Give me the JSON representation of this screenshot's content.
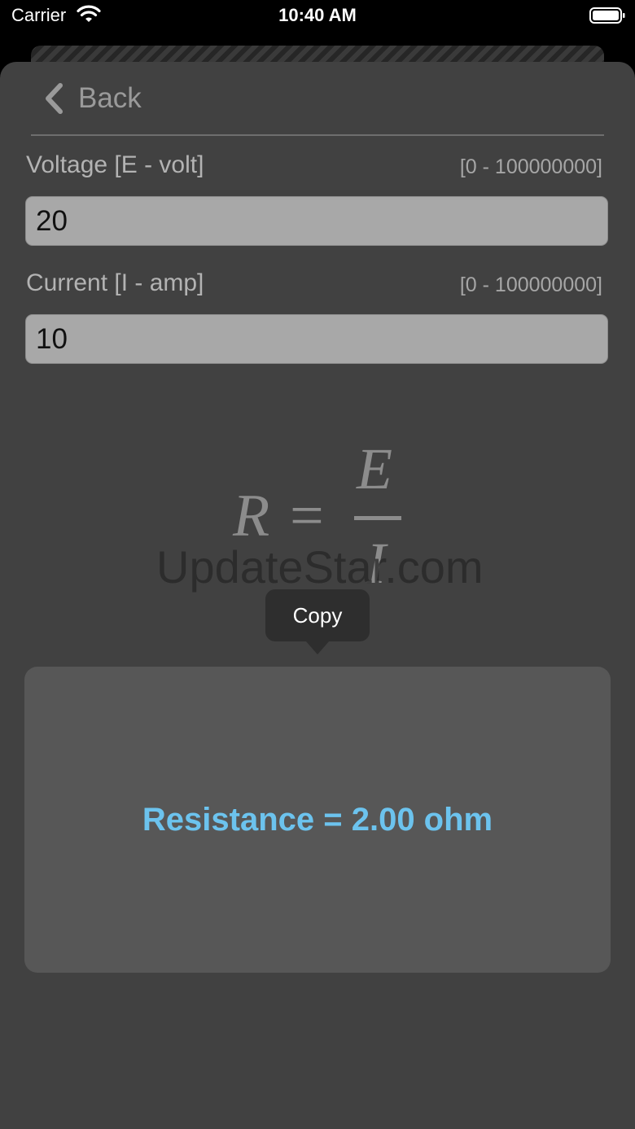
{
  "status_bar": {
    "carrier": "Carrier",
    "time": "10:40 AM"
  },
  "nav": {
    "back_label": "Back"
  },
  "voltage": {
    "label": "Voltage [E - volt]",
    "range": "[0 - 100000000]",
    "value": "20"
  },
  "current": {
    "label": "Current [I - amp]",
    "range": "[0 - 100000000]",
    "value": "10"
  },
  "formula": {
    "lhs": "R",
    "equals": "=",
    "numerator": "E",
    "denominator": "I"
  },
  "watermark": "UpdateStar.com",
  "tooltip": {
    "copy_label": "Copy"
  },
  "result": {
    "text": "Resistance = 2.00 ohm"
  },
  "colors": {
    "sheet_background": "#414141",
    "input_background": "#a8a8a8",
    "result_panel": "#575757",
    "result_text": "#6cc3ee"
  }
}
